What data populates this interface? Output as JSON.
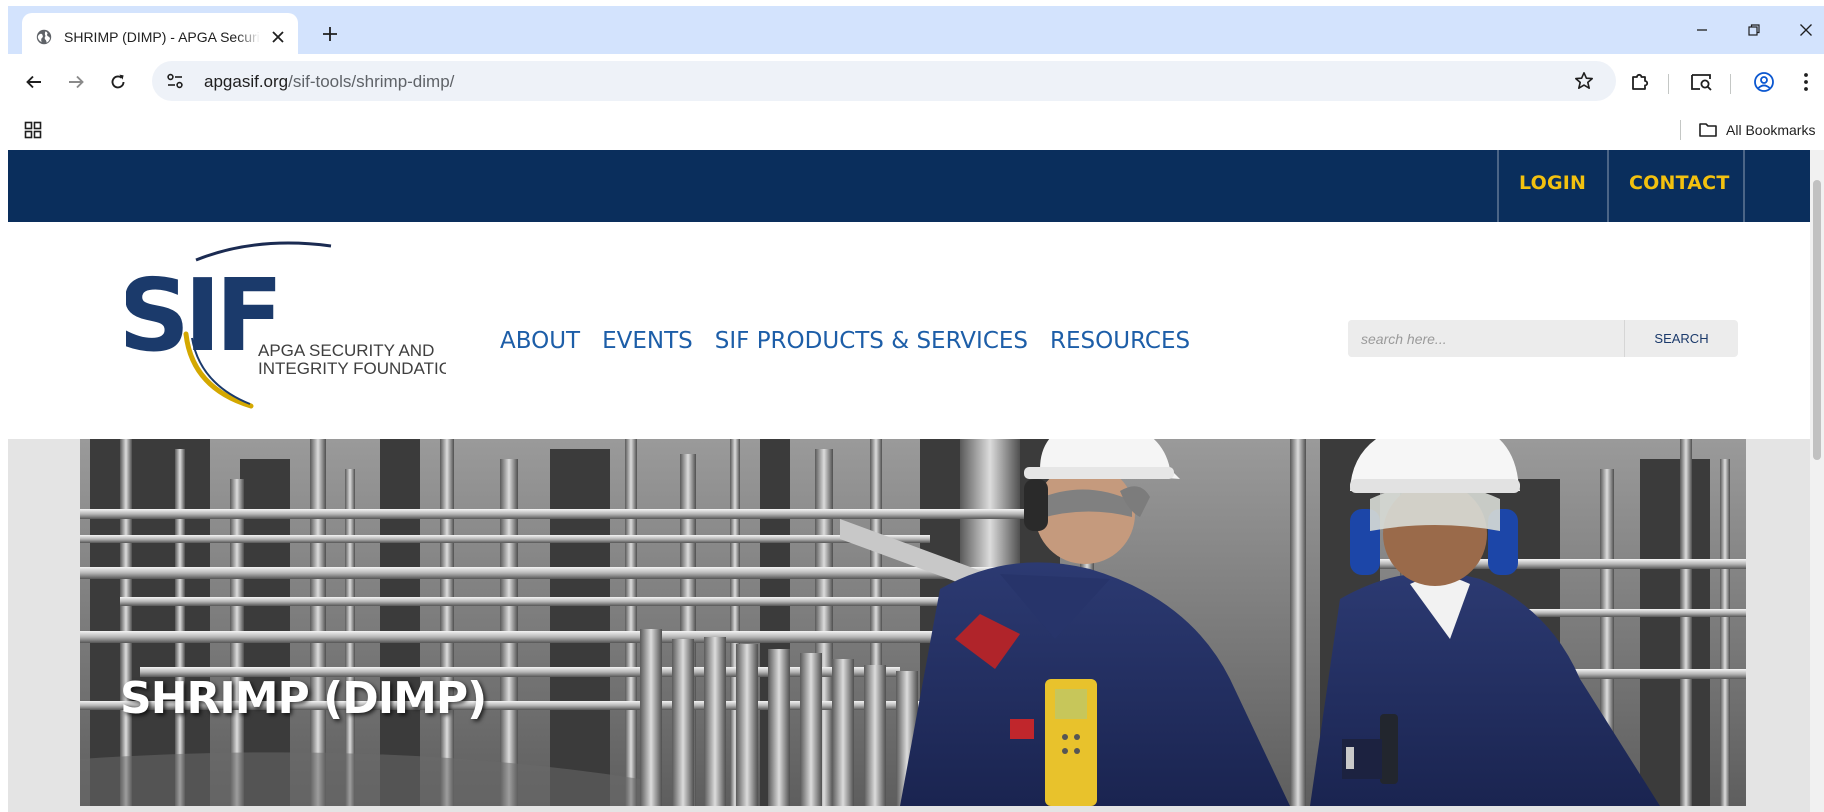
{
  "browser": {
    "tab": {
      "title": "SHRIMP (DIMP) - APGA Security and Integrity Foundation"
    },
    "address_bar": {
      "domain": "apgasif.org",
      "path": "/sif-tools/shrimp-dimp/"
    },
    "bookmarks": {
      "all_bookmarks_label": "All Bookmarks"
    }
  },
  "site": {
    "top_links": {
      "login": "LOGIN",
      "contact": "CONTACT"
    },
    "logo": {
      "mark": "SIF",
      "tagline_line1": "APGA SECURITY AND",
      "tagline_line2": "INTEGRITY FOUNDATION"
    },
    "nav": [
      "ABOUT",
      "EVENTS",
      "SIF PRODUCTS & SERVICES",
      "RESOURCES"
    ],
    "search": {
      "placeholder": "search here...",
      "button_label": "SEARCH"
    },
    "hero": {
      "title": "SHRIMP (DIMP)"
    }
  },
  "colors": {
    "chrome_tabstrip": "#d3e3fd",
    "top_bar": "#0a2e5c",
    "top_link": "#f3c10f",
    "nav_link": "#1d5ea8",
    "page_background": "#e4e4e4"
  }
}
